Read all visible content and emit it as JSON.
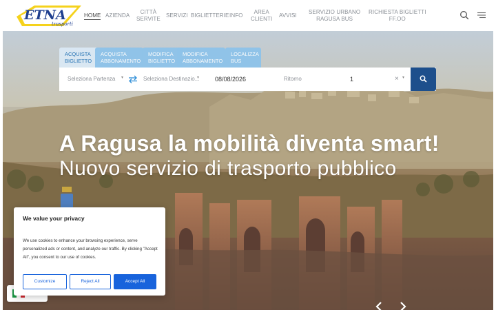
{
  "brand": {
    "name": "ETNA",
    "tagline": "trasporti"
  },
  "nav": {
    "items": [
      {
        "label": "HOME",
        "active": true
      },
      {
        "label": "AZIENDA"
      },
      {
        "label": "CITTÀ\nSERVITE"
      },
      {
        "label": "SERVIZI"
      },
      {
        "label": "BIGLIETTERIE"
      },
      {
        "label": "INFO"
      },
      {
        "label": "AREA\nCLIENTI"
      },
      {
        "label": "AVVISI"
      },
      {
        "label": "SERVIZIO URBANO\nRAGUSA BUS"
      },
      {
        "label": "RICHIESTA BIGLIETTI\nFF.OO"
      }
    ],
    "icons": [
      "search-icon",
      "menu-icon"
    ]
  },
  "booking": {
    "tabs": [
      {
        "label": "ACQUISTA\nBIGLIETTO",
        "active": true
      },
      {
        "label": "ACQUISTA\nABBONAMENTO"
      },
      {
        "label": "MODIFICA\nBIGLIETTO"
      },
      {
        "label": "MODIFICA\nABBONAMENTO"
      },
      {
        "label": "LOCALIZZA\nBUS"
      }
    ],
    "departure_placeholder": "Seleziona Partenza",
    "destination_placeholder": "Seleziona Destinazio...",
    "date_value": "08/08/2026",
    "return_placeholder": "Ritorno",
    "passengers_value": "1",
    "clear_symbol": "×"
  },
  "hero": {
    "title": "A Ragusa la mobilità diventa smart!",
    "subtitle": "Nuovo servizio di trasporto pubblico"
  },
  "cookie": {
    "title": "We value your privacy",
    "text": "We use cookies to enhance your browsing experience, serve personalized ads or content, and analyze our traffic. By clicking \"Accept All\", you consent to our use of cookies.",
    "customize": "Customize",
    "reject": "Reject All",
    "accept": "Accept All"
  },
  "colors": {
    "accent": "#1d4f8c",
    "tab_bg": "#8ec3ea",
    "tab_active_bg": "#dbe9f5",
    "cookie_button": "#1863dc",
    "logo_yellow": "#f5d21c",
    "logo_blue": "#1f3f8f"
  }
}
